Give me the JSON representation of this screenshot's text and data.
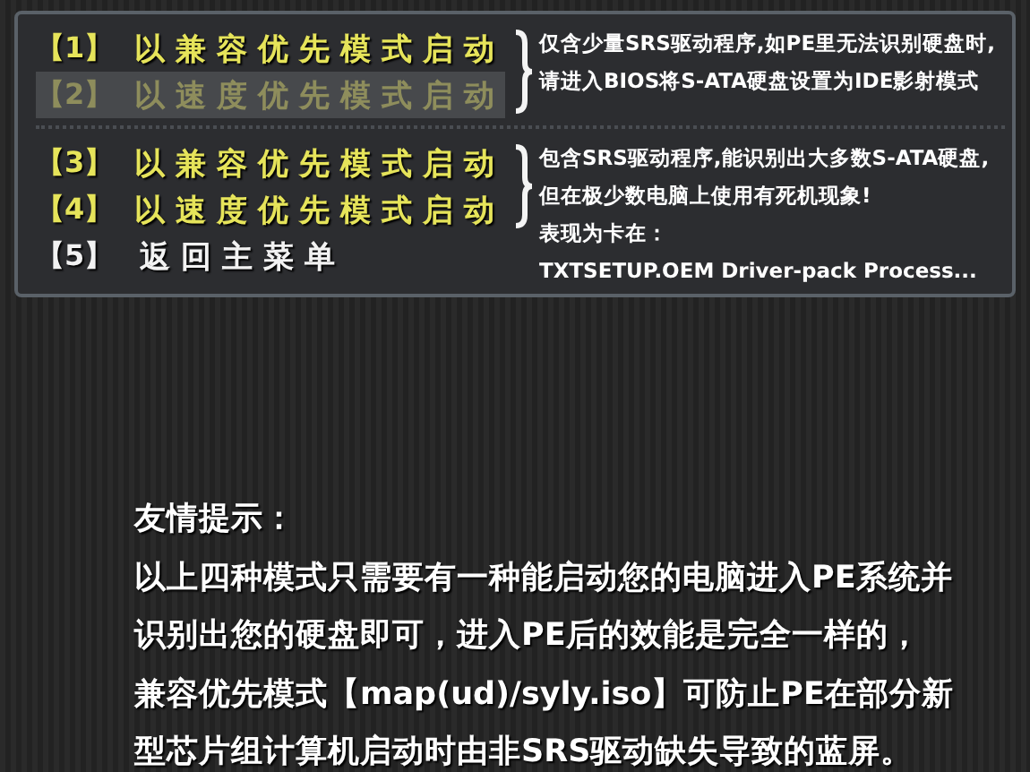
{
  "menu": {
    "groups": [
      {
        "items": [
          {
            "key": "【1】",
            "label": "以兼容优先模式启动",
            "color": "#e6e45a",
            "selected": false
          },
          {
            "key": "【2】",
            "label": "以速度优先模式启动",
            "color": "#8e8d5c",
            "selected": true
          }
        ],
        "note": [
          "仅含少量SRS驱动程序,如PE里无法识别硬盘时,",
          "请进入BIOS将S-ATA硬盘设置为IDE影射模式"
        ]
      },
      {
        "items": [
          {
            "key": "【3】",
            "label": "以兼容优先模式启动",
            "color": "#e6e45a",
            "selected": false
          },
          {
            "key": "【4】",
            "label": "以速度优先模式启动",
            "color": "#e6e45a",
            "selected": false
          },
          {
            "key": "【5】",
            "label": "返回主菜单",
            "color": "#f2f2f2",
            "selected": false
          }
        ],
        "note": [
          "包含SRS驱动程序,能识别出大多数S-ATA硬盘,",
          "但在极少数电脑上使用有死机现象!",
          "表现为卡在：",
          "TXTSETUP.OEM Driver-pack Process..."
        ]
      }
    ]
  },
  "tip": {
    "title": "友情提示：",
    "lines": [
      "以上四种模式只需要有一种能启动您的电脑进入PE系统并",
      "识别出您的硬盘即可，进入PE后的效能是完全一样的，",
      "兼容优先模式【map(ud)/syly.iso】可防止PE在部分新",
      "型芯片组计算机启动时由非SRS驱动缺失导致的蓝屏。"
    ]
  }
}
